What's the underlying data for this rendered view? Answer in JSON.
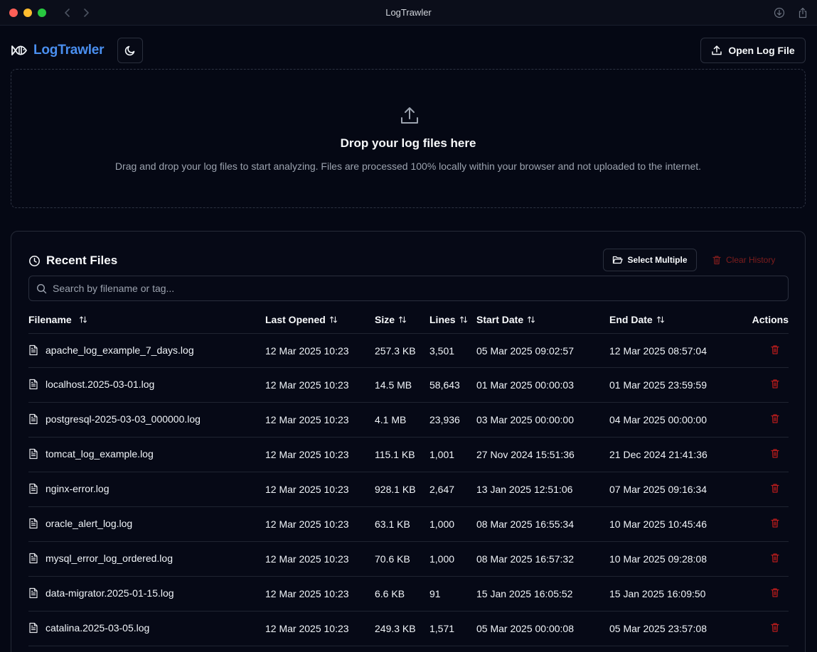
{
  "window": {
    "title": "LogTrawler"
  },
  "header": {
    "brand": "LogTrawler",
    "open_button": "Open Log File"
  },
  "dropzone": {
    "title": "Drop your log files here",
    "subtitle": "Drag and drop your log files to start analyzing. Files are processed 100% locally within your browser and not uploaded to the internet."
  },
  "recent": {
    "title": "Recent Files",
    "select_multiple": "Select Multiple",
    "clear_history": "Clear History",
    "search_placeholder": "Search by filename or tag...",
    "columns": {
      "filename": "Filename",
      "last_opened": "Last Opened",
      "size": "Size",
      "lines": "Lines",
      "start_date": "Start Date",
      "end_date": "End Date",
      "actions": "Actions"
    },
    "files": [
      {
        "name": "apache_log_example_7_days.log",
        "opened": "12 Mar 2025 10:23",
        "size": "257.3 KB",
        "lines": "3,501",
        "start": "05 Mar 2025 09:02:57",
        "end": "12 Mar 2025 08:57:04"
      },
      {
        "name": "localhost.2025-03-01.log",
        "opened": "12 Mar 2025 10:23",
        "size": "14.5 MB",
        "lines": "58,643",
        "start": "01 Mar 2025 00:00:03",
        "end": "01 Mar 2025 23:59:59"
      },
      {
        "name": "postgresql-2025-03-03_000000.log",
        "opened": "12 Mar 2025 10:23",
        "size": "4.1 MB",
        "lines": "23,936",
        "start": "03 Mar 2025 00:00:00",
        "end": "04 Mar 2025 00:00:00"
      },
      {
        "name": "tomcat_log_example.log",
        "opened": "12 Mar 2025 10:23",
        "size": "115.1 KB",
        "lines": "1,001",
        "start": "27 Nov 2024 15:51:36",
        "end": "21 Dec 2024 21:41:36"
      },
      {
        "name": "nginx-error.log",
        "opened": "12 Mar 2025 10:23",
        "size": "928.1 KB",
        "lines": "2,647",
        "start": "13 Jan 2025 12:51:06",
        "end": "07 Mar 2025 09:16:34"
      },
      {
        "name": "oracle_alert_log.log",
        "opened": "12 Mar 2025 10:23",
        "size": "63.1 KB",
        "lines": "1,000",
        "start": "08 Mar 2025 16:55:34",
        "end": "10 Mar 2025 10:45:46"
      },
      {
        "name": "mysql_error_log_ordered.log",
        "opened": "12 Mar 2025 10:23",
        "size": "70.6 KB",
        "lines": "1,000",
        "start": "08 Mar 2025 16:57:32",
        "end": "10 Mar 2025 09:28:08"
      },
      {
        "name": "data-migrator.2025-01-15.log",
        "opened": "12 Mar 2025 10:23",
        "size": "6.6 KB",
        "lines": "91",
        "start": "15 Jan 2025 16:05:52",
        "end": "15 Jan 2025 16:09:50"
      },
      {
        "name": "catalina.2025-03-05.log",
        "opened": "12 Mar 2025 10:23",
        "size": "249.3 KB",
        "lines": "1,571",
        "start": "05 Mar 2025 00:00:08",
        "end": "05 Mar 2025 23:57:08"
      },
      {
        "name": "",
        "opened": "",
        "size": "",
        "lines": "",
        "start": "",
        "end": ""
      }
    ]
  },
  "icons": {
    "file": "file-text-icon",
    "delete": "trash-icon",
    "sort": "sort-arrows-icon"
  },
  "colors": {
    "background": "#050814",
    "brand": "#4a8ff0",
    "danger": "#b91c1c",
    "border": "#2a2f3d"
  }
}
